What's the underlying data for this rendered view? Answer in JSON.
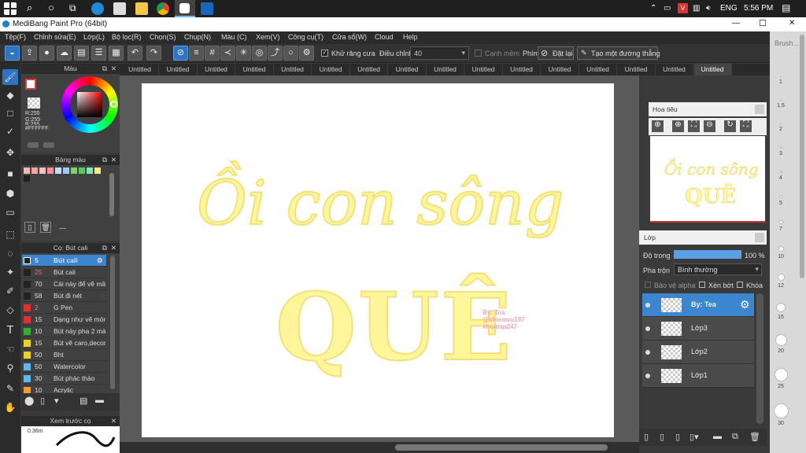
{
  "taskbar": {
    "lang": "ENG",
    "time": "5:56 PM"
  },
  "window": {
    "title": "MediBang Paint Pro (64bit)",
    "minimize": "—",
    "maximize": "☐",
    "close": "✕"
  },
  "menu": [
    "Tệp(F)",
    "Chỉnh sửa(E)",
    "Lớp(L)",
    "Bộ lọc(R)",
    "Chọn(S)",
    "Chụp(N)",
    "Màu (C)",
    "Xem(V)",
    "Công cụ(T)",
    "Cửa sổ(W)",
    "Cloud",
    "Help"
  ],
  "toolbar": {
    "antialias_label": "Khử răng cưa",
    "adjust_label": "Điều chỉnh",
    "adjust_value": "40",
    "soft_edge_label": "Cạnh mềm",
    "key_label": "Phím",
    "reset_label": "Đặt lại",
    "straight_label": "Tạo một đường thẳng"
  },
  "tabs": [
    "Untitled",
    "Untitled",
    "Untitled",
    "Untitled",
    "Untitled",
    "Untitled",
    "Untitled",
    "Untitled",
    "Untitled",
    "Untitled",
    "Untitled",
    "Untitled",
    "Untitled",
    "Untitled",
    "Untitled",
    "Untitled"
  ],
  "color_panel": {
    "title": "Màu",
    "r": "R:255",
    "g": "G:255",
    "b": "B:255",
    "hex": "#FFFFFF"
  },
  "palette_panel": {
    "title": "Bảng màu",
    "dash": "---"
  },
  "brush_panel": {
    "title": "Cọ: Bút cali",
    "items": [
      {
        "size": "5",
        "name": "Bút cali",
        "color": "#222222",
        "selected": true
      },
      {
        "size": "25",
        "name": "Bút cali",
        "color": "#222222"
      },
      {
        "size": "70",
        "name": "Cái này để vẽ mây",
        "color": "#222222"
      },
      {
        "size": "58",
        "name": "Bút đi nét",
        "color": "#222222"
      },
      {
        "size": "2",
        "name": "G Pen",
        "color": "#e03030"
      },
      {
        "size": "15",
        "name": "Dạng như vẽ móng",
        "color": "#e03030"
      },
      {
        "size": "10",
        "name": "Bút này pha 2 màu",
        "color": "#30b030"
      },
      {
        "size": "15",
        "name": "Bút vẽ caro,decor",
        "color": "#f0d020"
      },
      {
        "size": "50",
        "name": "Bht",
        "color": "#f0d020"
      },
      {
        "size": "50",
        "name": "Watercolor",
        "color": "#60b8e8"
      },
      {
        "size": "30",
        "name": "Bút phác thảo",
        "color": "#60b8e8"
      },
      {
        "size": "10",
        "name": "Acrylic",
        "color": "#f0a030"
      }
    ]
  },
  "preview_panel": {
    "title": "Xem trước cọ",
    "size": "0.36m"
  },
  "navigator": {
    "title": "Hoa tiêu"
  },
  "layer_panel": {
    "title": "Lớp",
    "opacity_label": "Độ trong",
    "opacity_value": "100 %",
    "blend_label": "Pha trộn",
    "blend_value": "Bình thường",
    "protect_alpha": "Bảo vệ alpha",
    "clip": "Xén bớt",
    "lock": "Khóa",
    "layers": [
      {
        "name": "By: Tea",
        "selected": true
      },
      {
        "name": "Lớp3"
      },
      {
        "name": "Lớp2"
      },
      {
        "name": "Lớp1"
      }
    ]
  },
  "artwork": {
    "line1": "Ồi con sông",
    "line2": "QUÊ",
    "sig1": "By: Tea",
    "sig2": "@khiemvu197",
    "sig3": "#hoidap247",
    "color": "#fff59a"
  },
  "brush_strip": {
    "title": "Brush...",
    "sizes": [
      "1",
      "1.5",
      "2",
      "3",
      "4",
      "5",
      "7",
      "10",
      "12",
      "15",
      "20",
      "25",
      "30"
    ]
  }
}
